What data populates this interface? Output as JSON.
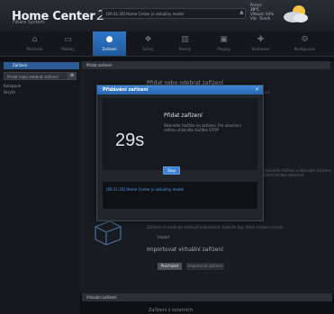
{
  "header": {
    "logo": "Home Center",
    "logo_mark": "2",
    "logo_sub": "Fibaro System",
    "notification": "[09:31:26] Home Center je aktuálny model",
    "weather": {
      "label1": "Počasí",
      "temp": "19°C",
      "label2": "Vlhkost: 64%",
      "label3": "Vítr: 7km/h"
    }
  },
  "nav": {
    "items": [
      {
        "label": "Místnosti",
        "icon": "home-icon"
      },
      {
        "label": "Moduly",
        "icon": "monitor-icon"
      },
      {
        "label": "Zařízení",
        "icon": "bulb-icon"
      },
      {
        "label": "Scény",
        "icon": "scenes-icon"
      },
      {
        "label": "Panely",
        "icon": "chart-icon"
      },
      {
        "label": "Pluginy",
        "icon": "puzzle-icon"
      },
      {
        "label": "Nastavení",
        "icon": "plus-icon"
      },
      {
        "label": "Konfigurace",
        "icon": "gear-icon"
      }
    ]
  },
  "sidebar": {
    "header": "Zařízení",
    "search": "Přidat nebo odebrat zařízení",
    "items": [
      "Kategorie",
      "Skryté"
    ]
  },
  "main": {
    "header": "Přidat zařízení",
    "bg_title1": "Přidat nebo odebrat zařízení",
    "bg_line1": "Stiskněte tlačítko pro přidání zařízení do sítě a pak aktivujte zařízení",
    "bg_line2": "Stiskněte tlačítko a aktivujte zařízení, které chcete odstranit",
    "bg_line3": "Zařízení se bude po stisknutí zobrazovat. Vyberte typ, které zařízení chcete",
    "bg_title2": "Importovat virtuální zařízení",
    "bg_button1": "Procházet",
    "bg_button2": "Importovat zařízení",
    "section2_header": "Virtuální zařízení",
    "section2_line": "Zařízení z ostatních"
  },
  "modal": {
    "title": "Přidávání zařízení",
    "close": "×",
    "countdown": "29s",
    "heading": "Přidat zařízení",
    "text": "Stiskněte tlačítko na zařízení. Pro ukončení režimu stiskněte tlačítko STOP",
    "stop_label": "Stop",
    "log": "[09:31:26] Home Center je aktuálny model"
  }
}
